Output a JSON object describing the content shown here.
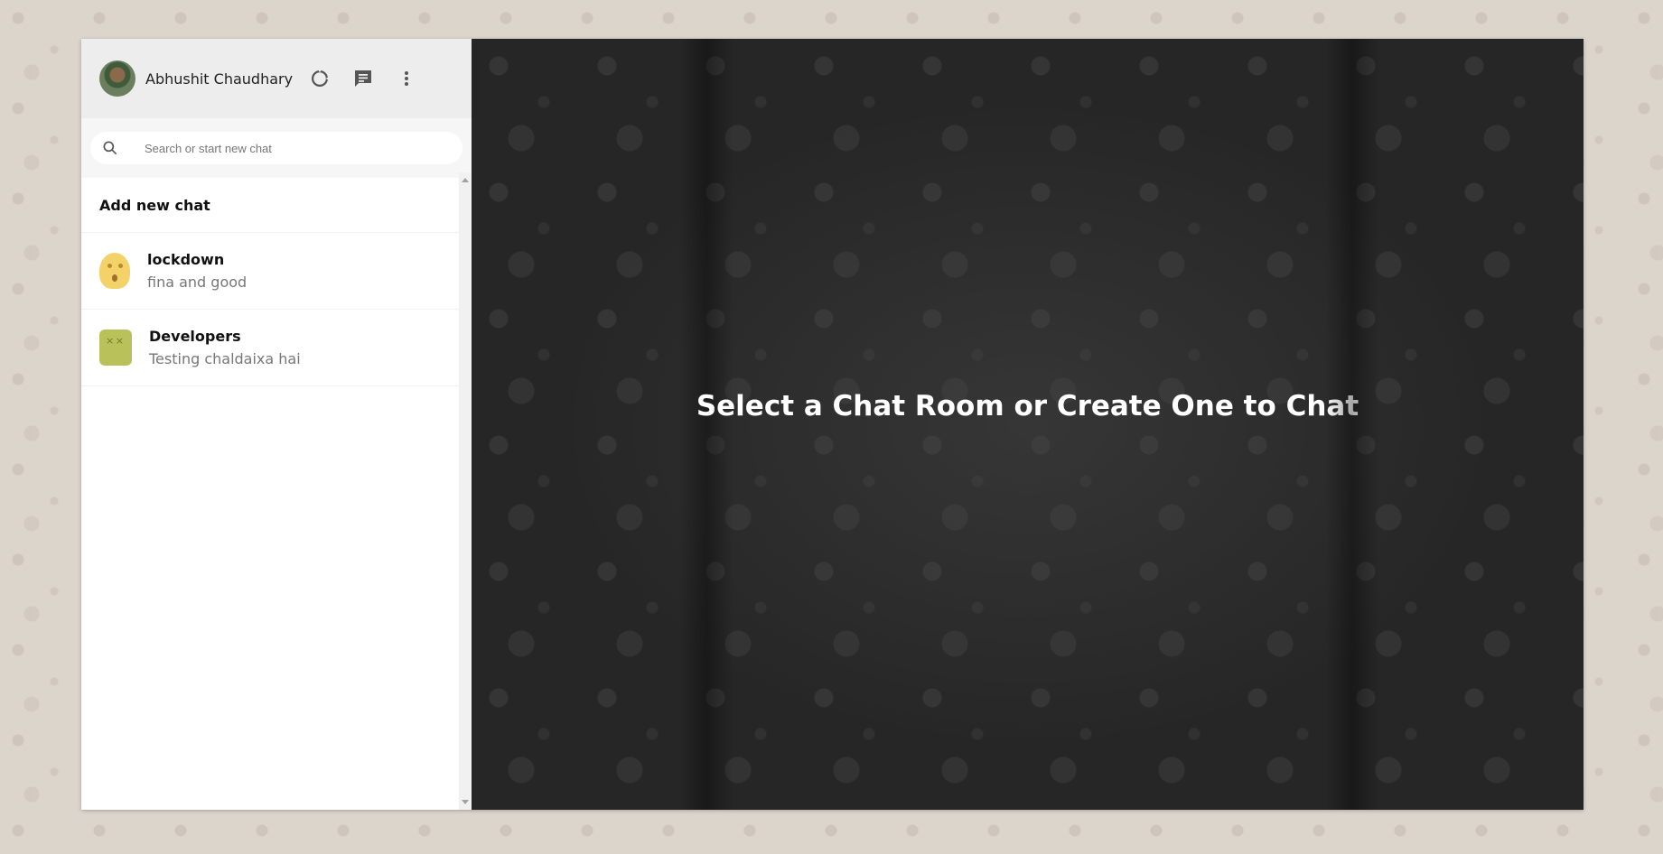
{
  "user": {
    "name": "Abhushit Chaudhary"
  },
  "header_icons": [
    "status-icon",
    "chat-icon",
    "more-vertical-icon"
  ],
  "search": {
    "placeholder": "Search or start new chat"
  },
  "add_chat_label": "Add new chat",
  "chats": [
    {
      "name": "lockdown",
      "last_message": "fina and good"
    },
    {
      "name": "Developers",
      "last_message": "Testing chaldaixa hai"
    }
  ],
  "main": {
    "welcome_text": "Select a Chat Room or Create One to Chat"
  },
  "colors": {
    "sidebar_header_bg": "#ededed",
    "main_bg": "#262626",
    "page_bg": "#dcd5cc"
  }
}
